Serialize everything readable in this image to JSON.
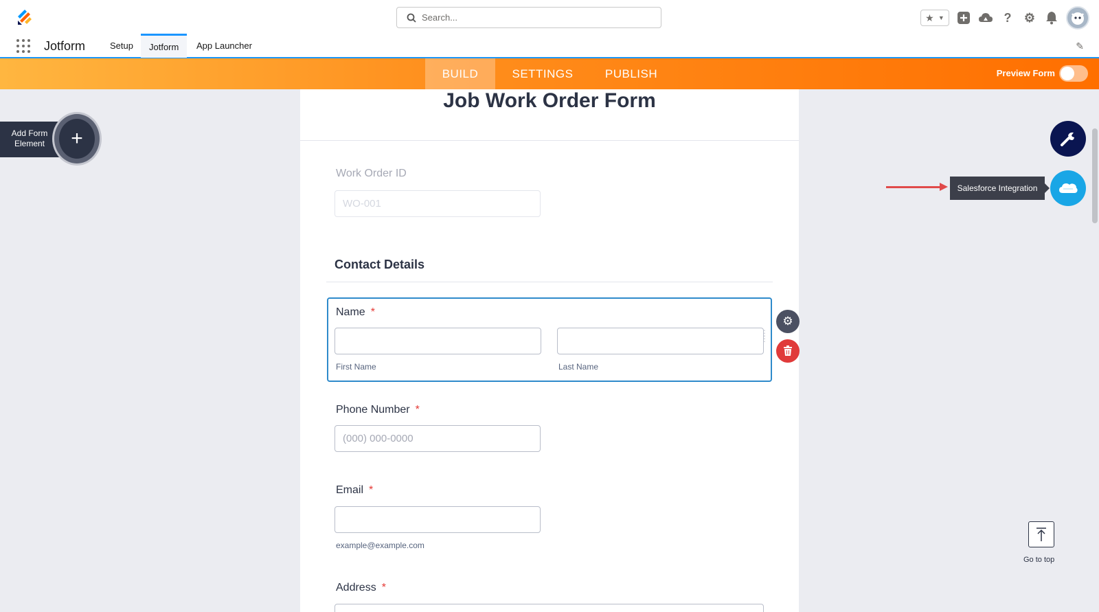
{
  "header": {
    "search_placeholder": "Search...",
    "app_name": "Jotform",
    "nav_tabs": [
      {
        "label": "Setup"
      },
      {
        "label": "Jotform"
      },
      {
        "label": "App Launcher"
      }
    ]
  },
  "builder_bar": {
    "tabs": [
      {
        "label": "BUILD"
      },
      {
        "label": "SETTINGS"
      },
      {
        "label": "PUBLISH"
      }
    ],
    "preview_label": "Preview Form",
    "preview_enabled": false
  },
  "left_panel": {
    "add_element_label_line1": "Add Form",
    "add_element_label_line2": "Element"
  },
  "form": {
    "title": "Job Work Order Form",
    "work_order": {
      "label": "Work Order ID",
      "placeholder": "WO-001"
    },
    "section_heading": "Contact Details",
    "name": {
      "label": "Name",
      "required_mark": "*",
      "first_sublabel": "First Name",
      "last_sublabel": "Last Name"
    },
    "phone": {
      "label": "Phone Number",
      "required_mark": "*",
      "placeholder": "(000) 000-0000"
    },
    "email": {
      "label": "Email",
      "required_mark": "*",
      "sublabel": "example@example.com"
    },
    "address": {
      "label": "Address",
      "required_mark": "*"
    }
  },
  "right_panel": {
    "tooltip": "Salesforce Integration",
    "go_to_top_label": "Go to top"
  },
  "icons": {
    "logo": "jotform-logo-icon",
    "search": "search-icon",
    "favorites": "star-icon",
    "add": "plus-square-icon",
    "trailhead": "cloud-trailhead-icon",
    "help": "help-icon",
    "settings": "gear-icon",
    "notifications": "bell-icon",
    "edit": "pencil-icon",
    "form_designer": "wrench-icon",
    "salesforce": "salesforce-cloud-icon",
    "field_settings": "gear-icon",
    "delete": "trash-icon",
    "go_to_top": "arrow-up-icon"
  },
  "colors": {
    "accent_blue": "#1b96ff",
    "builder_bar_start": "#ffb640",
    "builder_bar_end": "#ff6f00",
    "selected_field_border": "#2e8acb",
    "required": "#e53935",
    "navy": "#0a1551",
    "salesforce_blue": "#19a6e6",
    "delete_red": "#e03a3a"
  }
}
